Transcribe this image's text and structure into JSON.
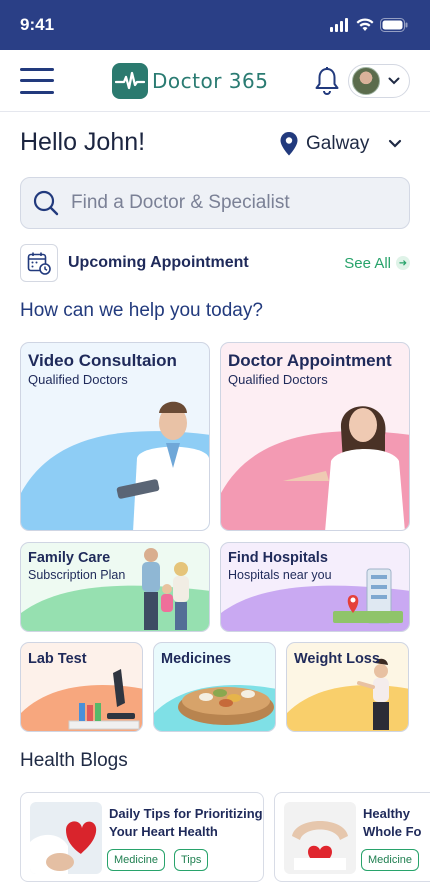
{
  "status": {
    "time": "9:41"
  },
  "header": {
    "logo_word": "Doctor",
    "logo_num": "365"
  },
  "greeting": "Hello John!",
  "location": "Galway",
  "search": {
    "placeholder": "Find a Doctor & Specialist"
  },
  "appointment": {
    "label": "Upcoming Appointment",
    "see_all": "See All"
  },
  "help_title": "How can we help you today?",
  "services": [
    {
      "title": "Video Consultaion",
      "subtitle": "Qualified Doctors",
      "color": "#8ecdf5"
    },
    {
      "title": "Doctor Appointment",
      "subtitle": "Qualified Doctors",
      "color": "#f39ab3"
    },
    {
      "title": "Family Care",
      "subtitle": "Subscription Plan",
      "color": "#96e0b0"
    },
    {
      "title": "Find Hospitals",
      "subtitle": "Hospitals near you",
      "color": "#c9a9f2"
    },
    {
      "title": "Lab Test",
      "color": "#f7a77e"
    },
    {
      "title": "Medicines",
      "color": "#7fe0e6"
    },
    {
      "title": "Weight Loss",
      "color": "#f9cf6b"
    }
  ],
  "blogs_title": "Health Blogs",
  "blogs": [
    {
      "title": "Daily Tips for Prioritizing Your Heart Health",
      "tags": [
        "Medicine",
        "Tips"
      ]
    },
    {
      "title": "Healthy Whole Fo",
      "tags": [
        "Medicine"
      ]
    }
  ],
  "colors": {
    "brand": "#2a3f86",
    "accent_green": "#28a36b",
    "logo": "#2a7b72"
  }
}
